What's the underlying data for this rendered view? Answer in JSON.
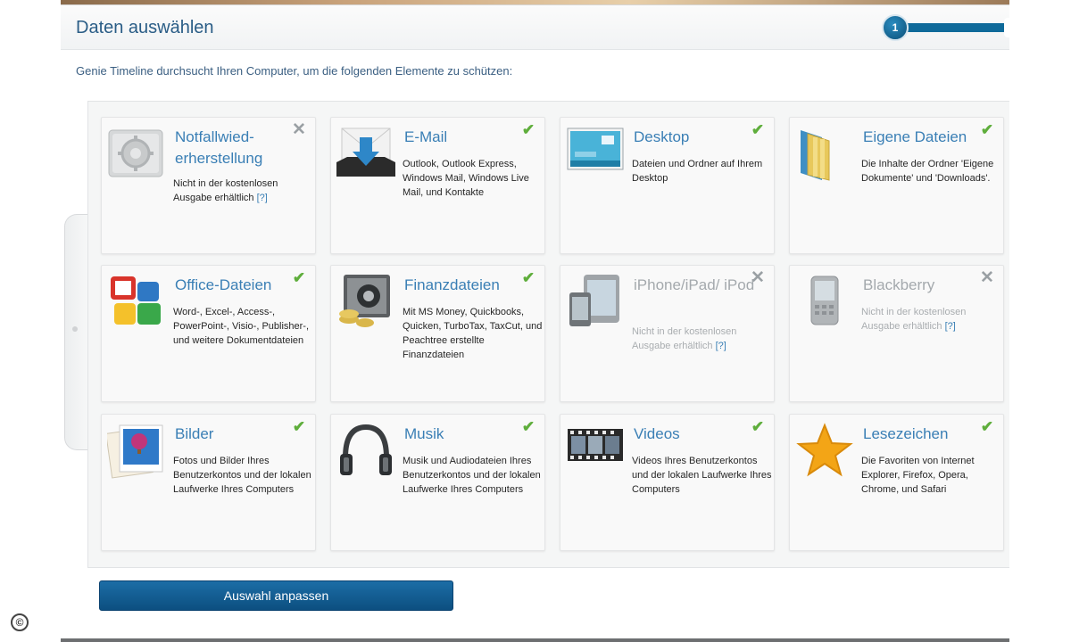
{
  "header": {
    "title": "Daten auswählen",
    "step_number": "1"
  },
  "intro": "Genie Timeline durchsucht Ihren Computer, um die folgenden Elemente zu schützen:",
  "colors": {
    "accent": "#3a7fb5",
    "check": "#5fae3c",
    "button": "#0c4f80"
  },
  "tiles": [
    {
      "title": "Notfallwied-erherstellung",
      "desc": "Nicht in der kostenlosen Ausgabe erhältlich",
      "help": "[?]",
      "status": "unavailable",
      "icon": "recovery-gear-icon"
    },
    {
      "title": "E-Mail",
      "desc": "Outlook, Outlook Express, Windows Mail, Windows Live Mail, und Kontakte",
      "status": "selected",
      "icon": "email-inbox-icon"
    },
    {
      "title": "Desktop",
      "desc": "Dateien und Ordner auf Ihrem Desktop",
      "status": "selected",
      "icon": "desktop-screen-icon"
    },
    {
      "title": "Eigene Dateien",
      "desc": "Die Inhalte der Ordner 'Eigene Dokumente' und 'Downloads'.",
      "status": "selected",
      "icon": "folder-icon"
    },
    {
      "title": "Office-Dateien",
      "desc": "Word-, Excel-, Access-, PowerPoint-, Visio-, Publisher-, und weitere Dokumentdateien",
      "status": "selected",
      "icon": "office-apps-icon"
    },
    {
      "title": "Finanzdateien",
      "desc": "Mit MS Money, Quickbooks, Quicken, TurboTax, TaxCut, und Peachtree erstellte Finanzdateien",
      "status": "selected",
      "icon": "safe-coins-icon"
    },
    {
      "title": "iPhone/iPad/ iPod",
      "desc": "Nicht in der kostenlosen Ausgabe erhältlich",
      "help": "[?]",
      "status": "unavailable",
      "icon": "mobile-devices-icon"
    },
    {
      "title": "Blackberry",
      "desc": "Nicht in der kostenlosen Ausgabe erhältlich",
      "help": "[?]",
      "status": "unavailable",
      "icon": "blackberry-phone-icon"
    },
    {
      "title": "Bilder",
      "desc": "Fotos und Bilder Ihres Benutzerkontos und der lokalen Laufwerke Ihres Computers",
      "status": "selected",
      "icon": "photo-balloon-icon"
    },
    {
      "title": "Musik",
      "desc": "Musik und Audiodateien Ihres Benutzerkontos und der lokalen Laufwerke Ihres Computers",
      "status": "selected",
      "icon": "headphones-icon"
    },
    {
      "title": "Videos",
      "desc": "Videos Ihres Benutzerkontos und der lokalen Laufwerke Ihres Computers",
      "status": "selected",
      "icon": "film-strip-icon"
    },
    {
      "title": "Lesezeichen",
      "desc": "Die Favoriten von Internet Explorer, Firefox, Opera, Chrome, und Safari",
      "status": "selected",
      "icon": "star-icon"
    }
  ],
  "status_marks": {
    "selected": "✔",
    "unavailable": "✕"
  },
  "button_label": "Auswahl anpassen",
  "copyright_symbol": "©"
}
